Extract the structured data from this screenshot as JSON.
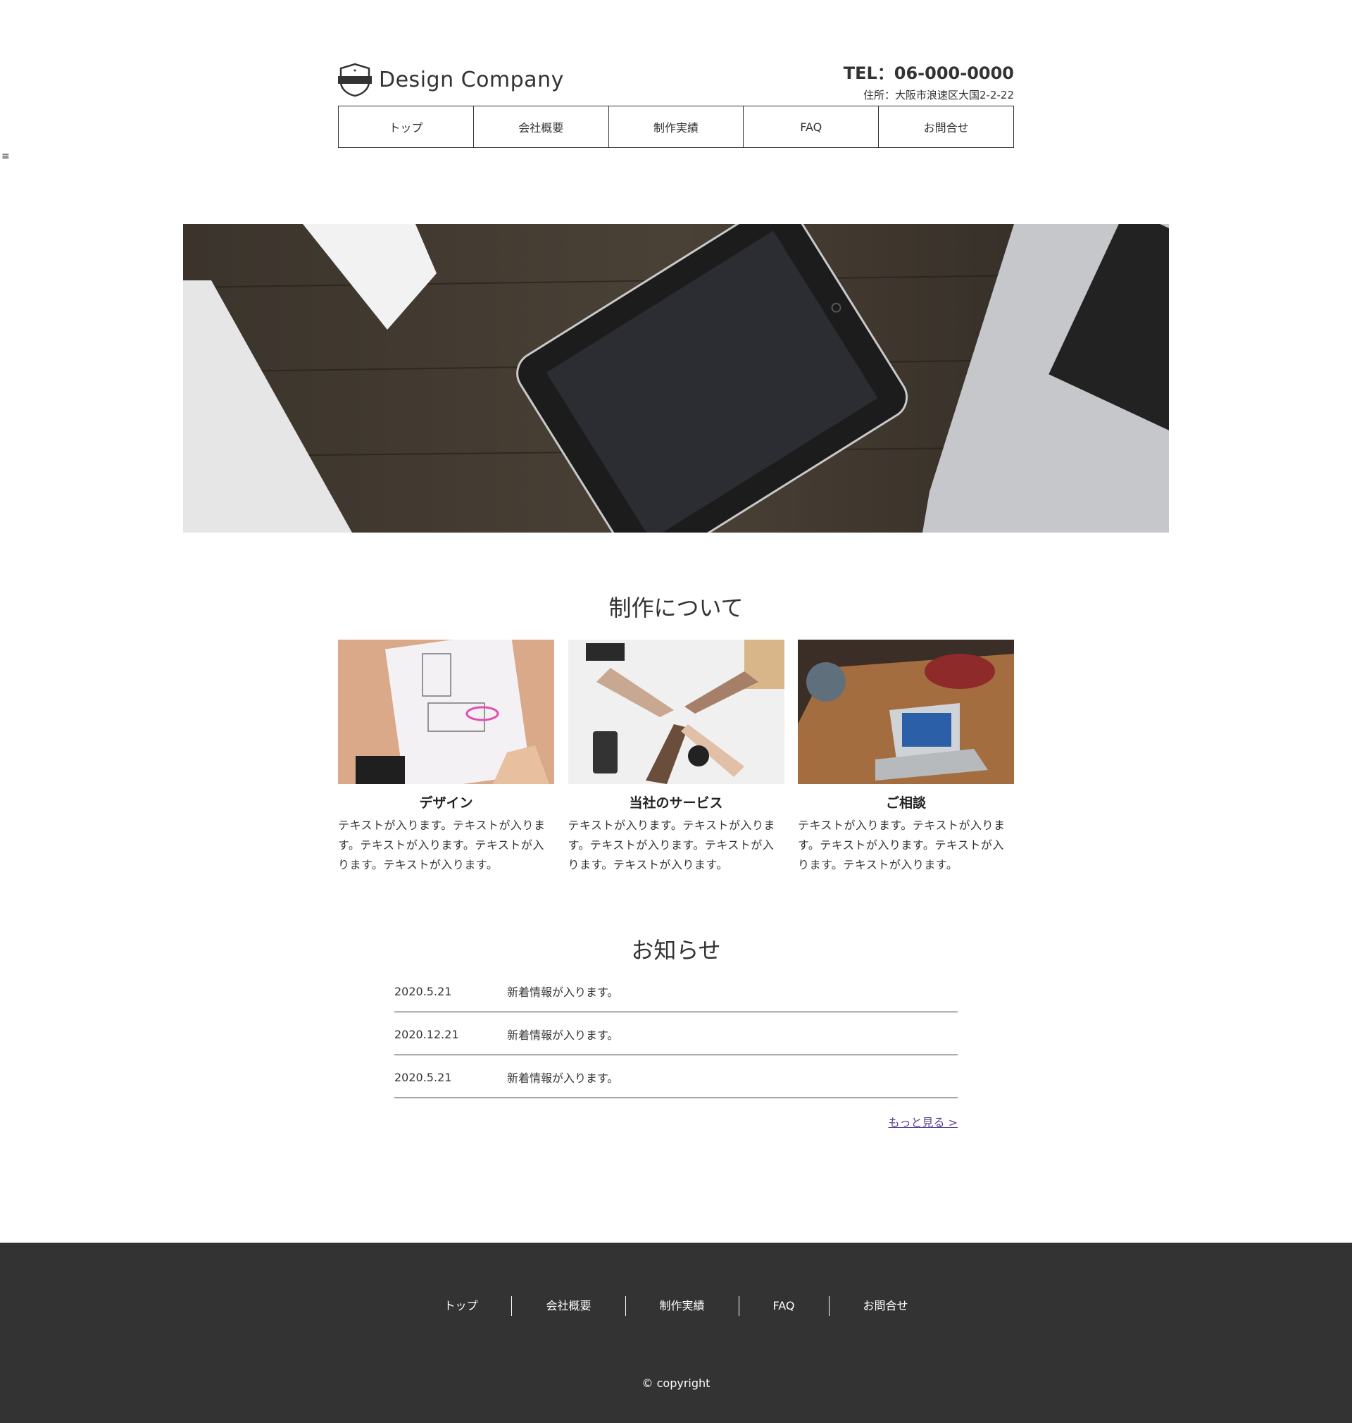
{
  "menu_icon": "≡",
  "header": {
    "logo_text": "Design Company",
    "tel": "TEL：06-000-0000",
    "address": "住所：大阪市浪速区大国2-2-22"
  },
  "nav": [
    "トップ",
    "会社概要",
    "制作実績",
    "FAQ",
    "お問合せ"
  ],
  "about": {
    "title": "制作について",
    "cards": [
      {
        "title": "デザイン",
        "text": "テキストが入ります。テキストが入ります。テキストが入ります。テキストが入ります。テキストが入ります。"
      },
      {
        "title": "当社のサービス",
        "text": "テキストが入ります。テキストが入ります。テキストが入ります。テキストが入ります。テキストが入ります。"
      },
      {
        "title": "ご相談",
        "text": "テキストが入ります。テキストが入ります。テキストが入ります。テキストが入ります。テキストが入ります。"
      }
    ]
  },
  "news": {
    "title": "お知らせ",
    "items": [
      {
        "date": "2020.5.21",
        "text": "新着情報が入ります。"
      },
      {
        "date": "2020.12.21",
        "text": "新着情報が入ります。"
      },
      {
        "date": "2020.5.21",
        "text": "新着情報が入ります。"
      }
    ],
    "more": "もっと見る >"
  },
  "footer": {
    "nav": [
      "トップ",
      "会社概要",
      "制作実績",
      "FAQ",
      "お問合せ"
    ],
    "copyright": "© copyright"
  },
  "colors": {
    "text": "#333333",
    "footer_bg": "#333333",
    "link": "#5b3e8f"
  }
}
